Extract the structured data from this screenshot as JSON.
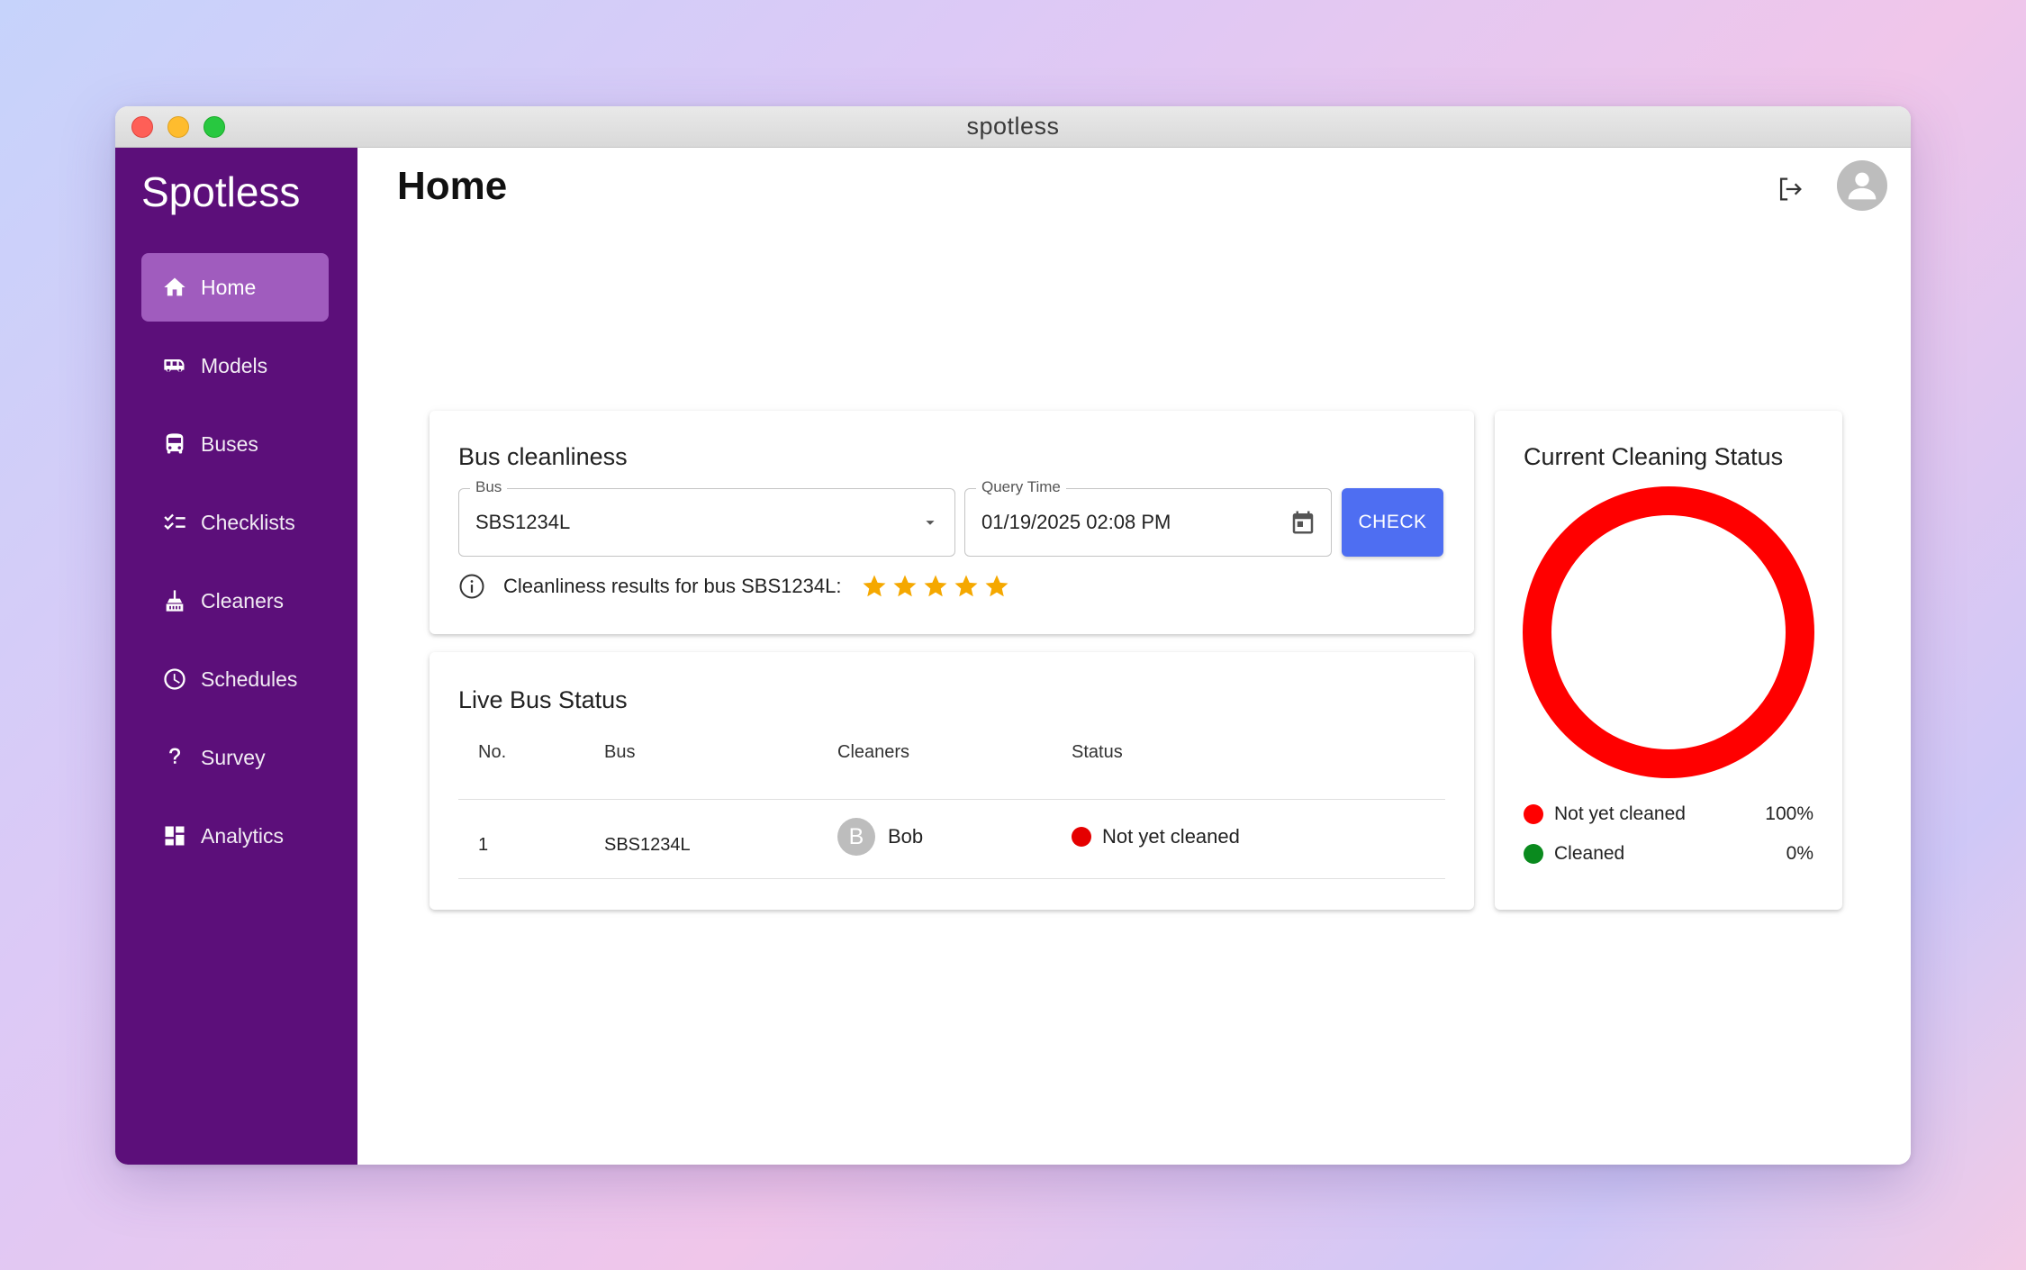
{
  "window": {
    "title": "spotless"
  },
  "sidebar": {
    "brand": "Spotless",
    "items": [
      {
        "label": "Home",
        "icon": "home-icon",
        "active": true
      },
      {
        "label": "Models",
        "icon": "bus-side-icon"
      },
      {
        "label": "Buses",
        "icon": "bus-front-icon"
      },
      {
        "label": "Checklists",
        "icon": "checklist-icon"
      },
      {
        "label": "Cleaners",
        "icon": "broom-icon"
      },
      {
        "label": "Schedules",
        "icon": "clock-icon"
      },
      {
        "label": "Survey",
        "icon": "question-icon"
      },
      {
        "label": "Analytics",
        "icon": "dashboard-icon"
      }
    ]
  },
  "header": {
    "title": "Home"
  },
  "cleanliness": {
    "title": "Bus cleanliness",
    "bus_label": "Bus",
    "bus_value": "SBS1234L",
    "time_label": "Query Time",
    "time_value": "01/19/2025 02:08 PM",
    "check_label": "CHECK",
    "result_text": "Cleanliness results for bus SBS1234L:",
    "rating": 5,
    "rating_max": 5,
    "star_color": "#f5a800"
  },
  "live": {
    "title": "Live Bus Status",
    "columns": [
      "No.",
      "Bus",
      "Cleaners",
      "Status"
    ],
    "rows": [
      {
        "no": "1",
        "bus": "SBS1234L",
        "cleaner_initial": "B",
        "cleaner": "Bob",
        "status": "Not yet cleaned",
        "status_color": "#e50000"
      }
    ]
  },
  "status": {
    "title": "Current Cleaning Status",
    "legend": [
      {
        "label": "Not yet cleaned",
        "value": "100%",
        "color": "#ff0000"
      },
      {
        "label": "Cleaned",
        "value": "0%",
        "color": "#0a8a1e"
      }
    ]
  },
  "colors": {
    "sidebar": "#5c0f7a",
    "active_nav": "#a05cbe",
    "accent": "#4e6ef2"
  }
}
